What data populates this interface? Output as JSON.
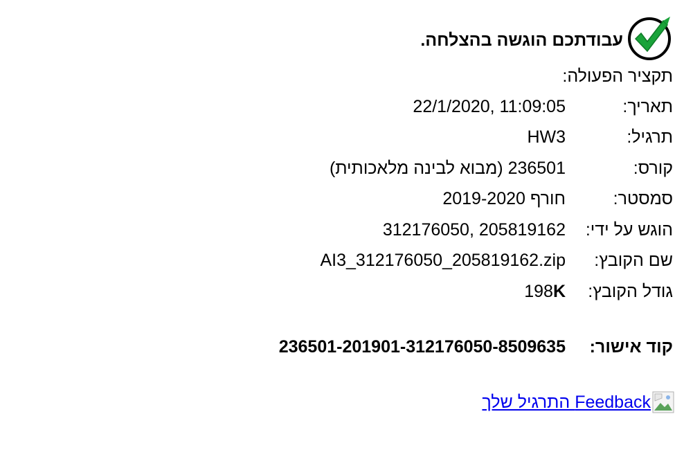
{
  "header": {
    "title": "עבודתכם הוגשה בהצלחה."
  },
  "summary_label": "תקציר הפעולה:",
  "details": [
    {
      "label": "תאריך:",
      "value": "22/1/2020, 11:09:05"
    },
    {
      "label": "תרגיל:",
      "value": "HW3"
    },
    {
      "label": "קורס:",
      "value": "236501 (מבוא לבינה מלאכותית)"
    },
    {
      "label": "סמסטר:",
      "value": "חורף 2019-2020"
    },
    {
      "label": "הוגש על ידי:",
      "value": "312176050, 205819162"
    },
    {
      "label": "שם הקובץ:",
      "value": "AI3_312176050_205819162.zip"
    },
    {
      "label": "גודל הקובץ:",
      "value_number": "198",
      "value_unit": "K"
    }
  ],
  "approval": {
    "label": "קוד אישור:",
    "code": "236501-201901-312176050-8509635"
  },
  "feedback": {
    "link_text": "Feedback התרגיל שלך",
    "icon": "broken-image-icon"
  },
  "colors": {
    "check_green": "#1aa33a",
    "link": "#0000ee"
  }
}
